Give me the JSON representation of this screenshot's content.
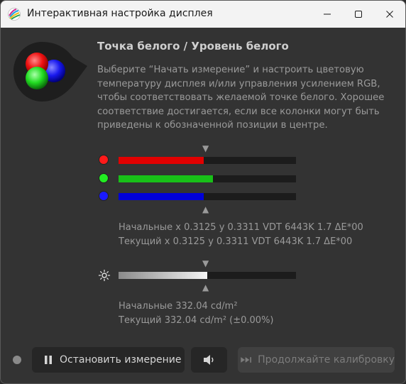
{
  "window": {
    "title": "Интерактивная настройка дисплея",
    "controls": [
      "minimize-icon",
      "maximize-icon",
      "close-icon"
    ]
  },
  "header": {
    "heading": "Точка белого / Уровень белого",
    "description": "Выберите “Начать измерение” и настроить цветовую температуру дисплея и/или управления усилением RGB, чтобы соответствовать желаемой точке белого. Хорошее соответствие достигается, если все колонки могут быть приведены к обозначенной позиции в центре."
  },
  "rgb_bars": [
    {
      "name": "red",
      "color": "#e10000",
      "dot_color": "#ff1a1a",
      "value": 0.48
    },
    {
      "name": "green",
      "color": "#18c018",
      "dot_color": "#22ee22",
      "value": 0.53
    },
    {
      "name": "blue",
      "color": "#0000d8",
      "dot_color": "#1a1aff",
      "value": 0.48
    }
  ],
  "rgb_target": 0.5,
  "white_point": {
    "initial": "Начальные x 0.3125 y 0.3311 VDT 6443K 1.7 ΔE*00",
    "current": "Текущий x 0.3125 y 0.3311 VDT 6443K 1.7 ΔE*00"
  },
  "luminance_bar": {
    "value": 0.5,
    "target": 0.5,
    "icon": "sun-icon"
  },
  "luminance": {
    "initial": "Начальные 332.04 cd/m²",
    "current": "Текущий 332.04 cd/m² (±0.00%)"
  },
  "footer": {
    "stop_label": "Остановить измерение",
    "stop_icon": "pause-icon",
    "sound_icon": "speaker-icon",
    "continue_label": "Продолжайте калибровку",
    "continue_icon": "skip-forward-icon"
  }
}
